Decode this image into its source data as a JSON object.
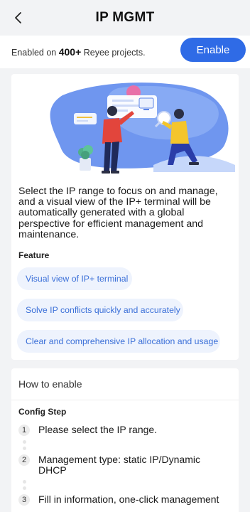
{
  "header": {
    "title": "IP MGMT",
    "back_icon": "chevron-left-icon"
  },
  "banner": {
    "prefix": "Enabled on ",
    "count": "400+",
    "suffix": " Reyee projects.",
    "enable_label": "Enable",
    "enable_color": "#2f6be6"
  },
  "intro": {
    "description": "Select the IP range to focus on and manage, and a visual view of the IP+ terminal will be automatically generated with a global perspective for efficient management and maintenance.",
    "feature_label": "Feature",
    "features": [
      "Visual view of IP+ terminal",
      "Solve IP conflicts quickly and accurately",
      "Clear and comprehensive IP allocation and usage"
    ]
  },
  "how_to": {
    "title": "How to enable",
    "config_label": "Config Step",
    "steps": [
      {
        "num": "1",
        "text": "Please select the IP range."
      },
      {
        "num": "2",
        "text": "Management type: static IP/Dynamic DHCP"
      },
      {
        "num": "3",
        "text": "Fill in information, one-click management"
      }
    ]
  }
}
